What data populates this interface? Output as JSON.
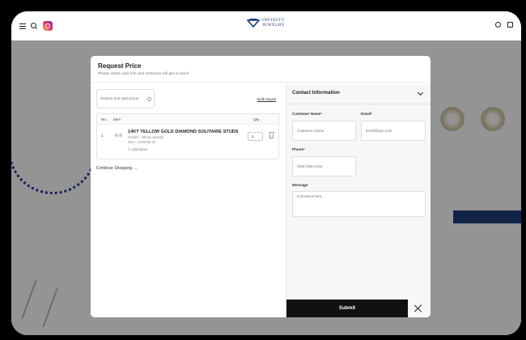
{
  "header": {
    "brand_line1": "INFINITY",
    "brand_line2": "JEWELRY",
    "icons": [
      "hamburger-icon",
      "search-icon",
      "instagram-icon",
      "user-icon",
      "bag-icon"
    ]
  },
  "modal": {
    "title": "Request Price",
    "subtitle": "Please share your info and someone will get in touch",
    "search_placeholder": "Search and add produ",
    "bulk_import": "Bulk Import",
    "table": {
      "headers": {
        "no": "No.",
        "item": "Item",
        "qty": "Qty"
      },
      "rows": [
        {
          "no": "1",
          "name": "14KT YELLOW GOLD DIAMOND SOLITAIRE STUDS",
          "vendor": "Vendor : Infinity Jewelry",
          "sku": "SKU : 2049782-31",
          "note": "Add Notes",
          "qty": "1"
        }
      ]
    },
    "continue_shopping": "Continue Shopping →",
    "contact": {
      "title": "Contact Information",
      "customer_name_label": "Customer Name",
      "customer_name_placeholder": "Customer Name",
      "email_label": "Email",
      "email_placeholder": "email@xyz.com",
      "phone_label": "Phone",
      "phone_placeholder": "(555) 555-1234",
      "message_label": "Message",
      "message_placeholder": "Comment here...",
      "required_mark": "*"
    },
    "submit": "Submit"
  },
  "colors": {
    "brand": "#1c3d7a",
    "submit_bg": "#111111",
    "required": "#dd2222"
  }
}
